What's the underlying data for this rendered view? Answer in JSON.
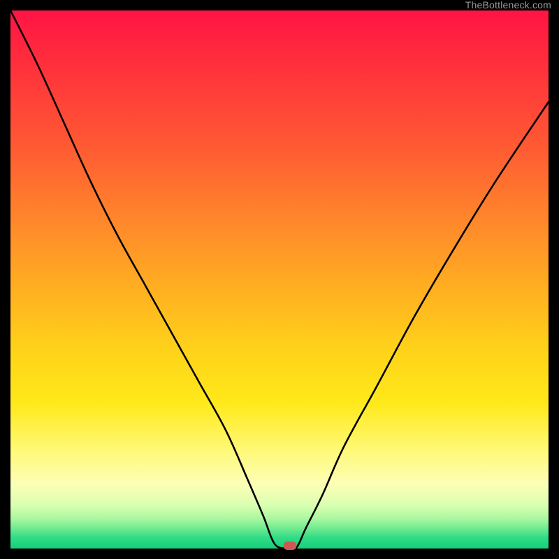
{
  "watermark": "TheBottleneck.com",
  "chart_data": {
    "type": "line",
    "title": "",
    "xlabel": "",
    "ylabel": "",
    "xlim": [
      0,
      100
    ],
    "ylim": [
      0,
      100
    ],
    "grid": false,
    "legend": false,
    "series": [
      {
        "name": "bottleneck-curve",
        "x": [
          0,
          5,
          10,
          15,
          20,
          25,
          30,
          35,
          40,
          44,
          47,
          49,
          51,
          53,
          55,
          58,
          62,
          68,
          75,
          82,
          90,
          100
        ],
        "y": [
          100,
          90,
          79,
          68,
          58,
          49,
          40,
          31,
          22,
          13,
          6,
          1,
          0,
          0,
          4,
          10,
          19,
          30,
          43,
          55,
          68,
          83
        ]
      }
    ],
    "marker": {
      "name": "optimal-point",
      "x": 52,
      "y": 0.5,
      "color": "#cb5b52"
    },
    "background_gradient": {
      "orientation": "vertical",
      "stops": [
        {
          "pos": 0.0,
          "color": "#ff1444"
        },
        {
          "pos": 0.4,
          "color": "#ff8a2a"
        },
        {
          "pos": 0.73,
          "color": "#ffe91a"
        },
        {
          "pos": 0.92,
          "color": "#d9ffb0"
        },
        {
          "pos": 1.0,
          "color": "#17d07b"
        }
      ]
    }
  }
}
